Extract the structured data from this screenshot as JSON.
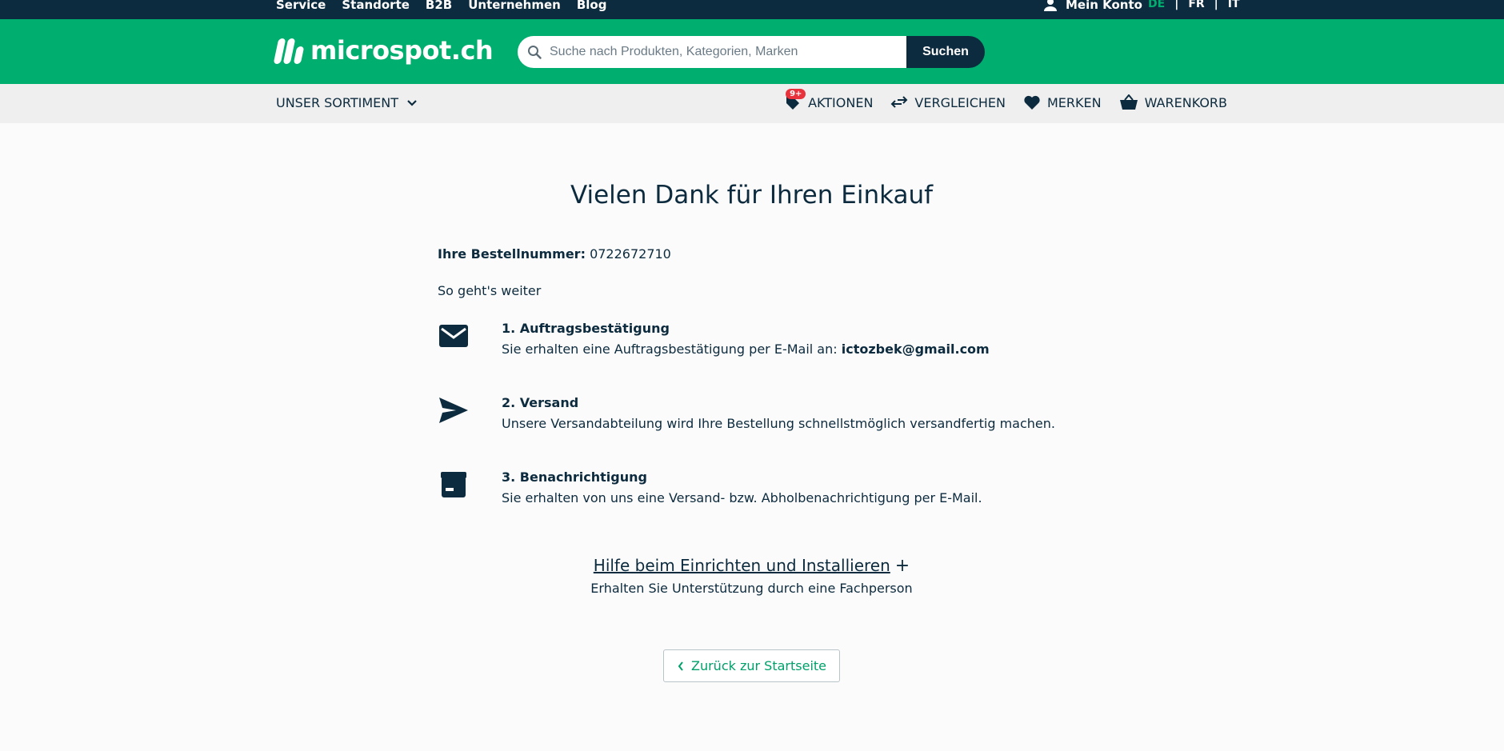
{
  "topbar": {
    "links": [
      "Service",
      "Standorte",
      "B2B",
      "Unternehmen",
      "Blog"
    ],
    "account_label": "Mein Konto",
    "languages": [
      "DE",
      "FR",
      "IT"
    ],
    "separator": "|",
    "active_language": "DE"
  },
  "header": {
    "logo_text": "microspot.ch",
    "search_placeholder": "Suche nach Produkten, Kategorien, Marken",
    "search_button": "Suchen"
  },
  "nav": {
    "sortiment_label": "UNSER SORTIMENT",
    "actions_badge": "9+",
    "actions_label": "AKTIONEN",
    "compare_label": "VERGLEICHEN",
    "wishlist_label": "MERKEN",
    "cart_label": "WARENKORB"
  },
  "confirmation": {
    "title": "Vielen Dank für Ihren Einkauf",
    "order_label": "Ihre Bestellnummer:",
    "order_number": "0722672710",
    "next_heading": "So geht's weiter",
    "steps": [
      {
        "title": "1. Auftragsbestätigung",
        "text": "Sie erhalten eine Auftragsbestätigung per E-Mail an:",
        "email": "ictozbek@gmail.com",
        "icon": "mail-icon"
      },
      {
        "title": "2. Versand",
        "text": "Unsere Versandabteilung wird Ihre Bestellung schnellstmöglich versandfertig machen.",
        "icon": "send-icon"
      },
      {
        "title": "3. Benachrichtigung",
        "text": "Sie erhalten von uns eine Versand- bzw. Abholbenachrichtigung per E-Mail.",
        "icon": "box-icon"
      }
    ],
    "help_link": "Hilfe beim Einrichten und Installieren",
    "help_plus": "+",
    "help_sub": "Erhalten Sie Unterstützung durch eine Fachperson",
    "back_button": "Zurück zur Startseite"
  },
  "colors": {
    "brand_green": "#00ae6f",
    "navy": "#0d2b3e",
    "badge_red": "#e8323c"
  }
}
